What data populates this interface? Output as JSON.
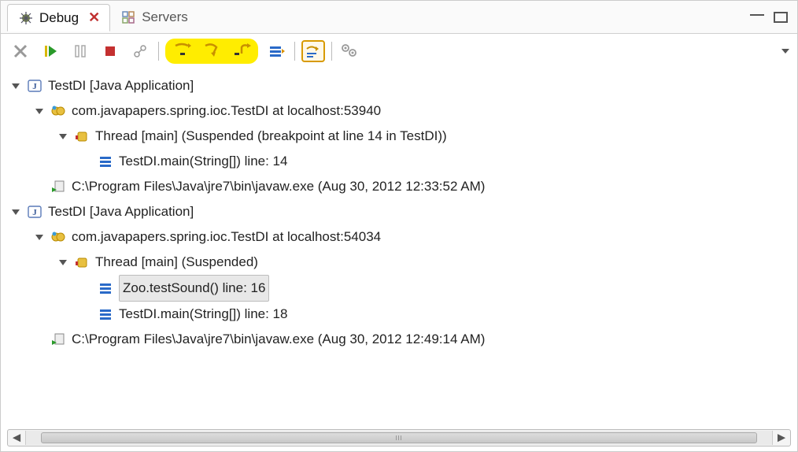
{
  "tabs": {
    "active": "Debug",
    "inactive": "Servers"
  },
  "tree": {
    "app1": {
      "title": "TestDI [Java Application]",
      "process": "com.javapapers.spring.ioc.TestDI at localhost:53940",
      "thread": "Thread [main] (Suspended (breakpoint at line 14 in TestDI))",
      "frame1": "TestDI.main(String[]) line: 14",
      "exe": "C:\\Program Files\\Java\\jre7\\bin\\javaw.exe (Aug 30, 2012 12:33:52 AM)"
    },
    "app2": {
      "title": "TestDI [Java Application]",
      "process": "com.javapapers.spring.ioc.TestDI at localhost:54034",
      "thread": "Thread [main] (Suspended)",
      "frame1": "Zoo.testSound() line: 16",
      "frame2": "TestDI.main(String[]) line: 18",
      "exe": "C:\\Program Files\\Java\\jre7\\bin\\javaw.exe (Aug 30, 2012 12:49:14 AM)"
    }
  }
}
